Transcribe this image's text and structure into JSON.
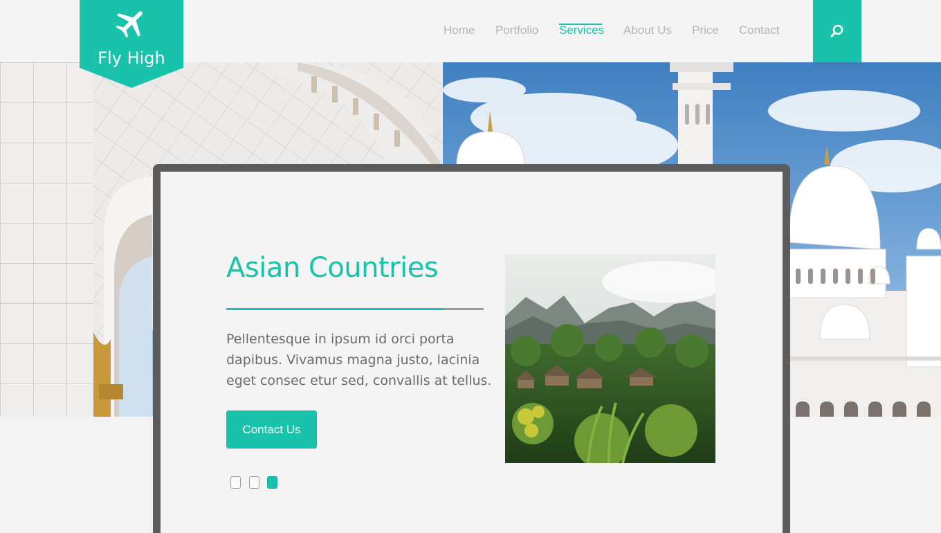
{
  "brand": {
    "name": "Fly High",
    "logo_icon": "airplane-icon",
    "accent_color": "#19c2ab"
  },
  "nav": {
    "items": [
      {
        "label": "Home",
        "active": false
      },
      {
        "label": "Portfolio",
        "active": false
      },
      {
        "label": "Services",
        "active": true
      },
      {
        "label": "About Us",
        "active": false
      },
      {
        "label": "Price",
        "active": false
      },
      {
        "label": "Contact",
        "active": false
      }
    ],
    "search_icon": "search-icon"
  },
  "slide": {
    "title": "Asian Countries",
    "body": "Pellentesque in ipsum id orci porta dapibus. Vivamus magna justo, lacinia eget consec etur sed, convallis at tellus.",
    "cta_label": "Contact Us",
    "photo": "mountain-village-photo"
  },
  "slider": {
    "count": 3,
    "active_index": 3
  }
}
